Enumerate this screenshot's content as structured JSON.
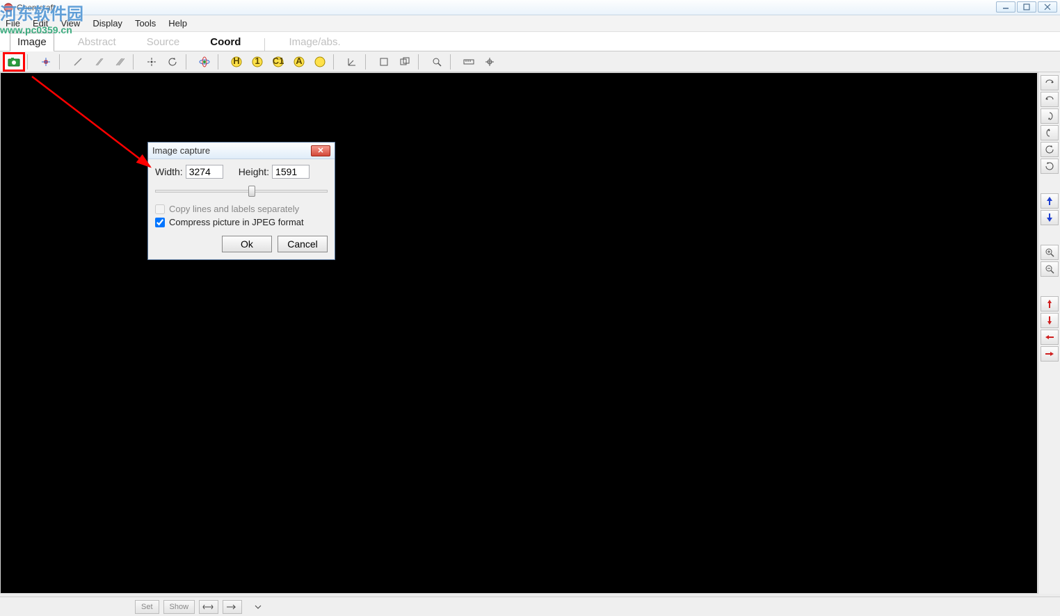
{
  "title": "Chemcraft",
  "watermark": {
    "name": "河东软件园",
    "url": "www.pc0359.cn"
  },
  "menu": {
    "file": "File",
    "edit": "Edit",
    "view": "View",
    "display": "Display",
    "tools": "Tools",
    "help": "Help"
  },
  "tabs": {
    "image": "Image",
    "abstract": "Abstract",
    "source": "Source",
    "coord": "Coord",
    "imageabs": "Image/abs."
  },
  "dialog": {
    "title": "Image capture",
    "width_label": "Width:",
    "width_value": "3274",
    "height_label": "Height:",
    "height_value": "1591",
    "copy_lines": "Copy lines and labels separately",
    "compress_jpeg": "Compress picture in JPEG format",
    "ok": "Ok",
    "cancel": "Cancel"
  },
  "statusbar": {
    "set": "Set",
    "show": "Show"
  }
}
